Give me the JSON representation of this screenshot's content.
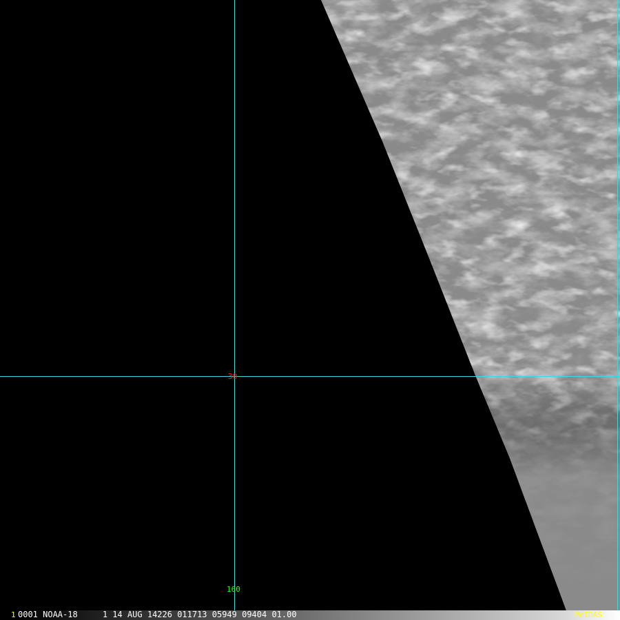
{
  "colors": {
    "background": "#000000",
    "grid_line": "#40d8d8",
    "latitude_label": "#ff2020",
    "longitude_label": "#20ff20",
    "status_text": "#ffffff",
    "frame_number": "#ffff00",
    "brand": "#ffff00",
    "cloud_base": "#8a8a8a"
  },
  "grid": {
    "latitude_label": "30",
    "longitude_label": "160"
  },
  "status_bar": {
    "frame_number": "1",
    "info": "0001 NOAA-18     1 14 AUG 14226 011713 05949 09404 01.00",
    "brand": "McIDAS"
  }
}
